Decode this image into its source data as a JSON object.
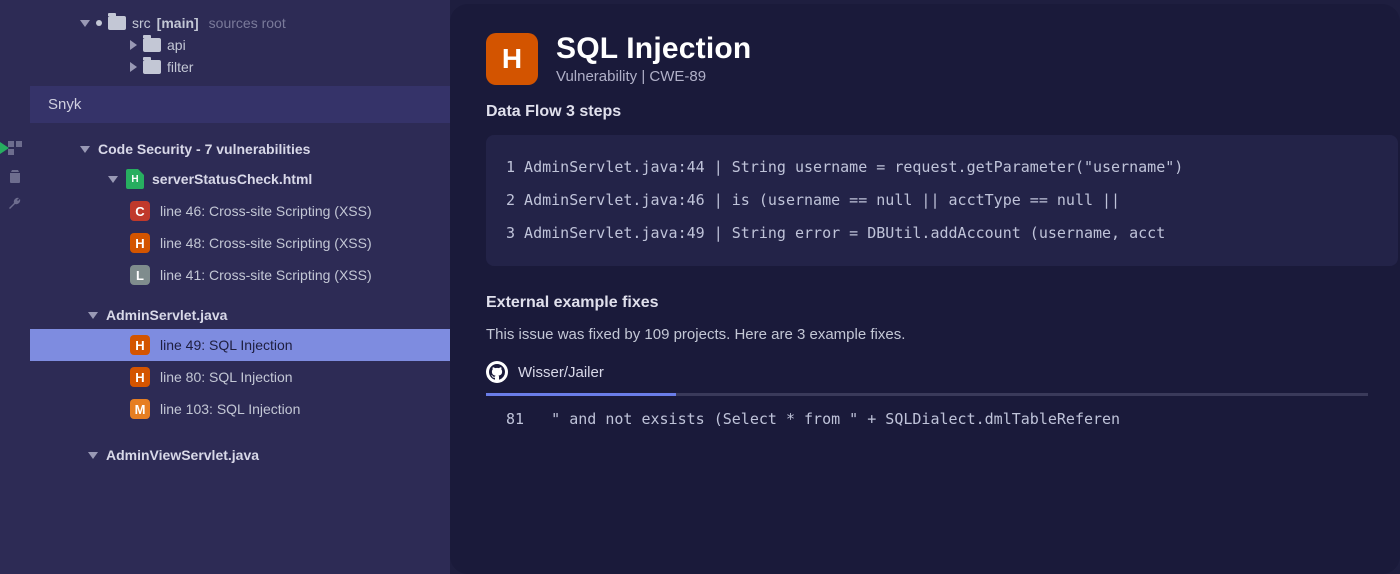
{
  "fileTree": {
    "root": {
      "name": "src",
      "branch": "[main]",
      "desc": "sources root"
    },
    "children": [
      {
        "name": "api"
      },
      {
        "name": "filter"
      }
    ]
  },
  "panelTitle": "Snyk",
  "vulnGroup": "Code Security - 7 vulnerabilities",
  "files": [
    {
      "name": "serverStatusCheck.html",
      "badge": "H",
      "items": [
        {
          "sev": "C",
          "label": "line 46: Cross-site Scripting (XSS)"
        },
        {
          "sev": "H",
          "label": "line 48: Cross-site Scripting (XSS)"
        },
        {
          "sev": "L",
          "label": "line 41: Cross-site Scripting (XSS)"
        }
      ]
    },
    {
      "name": "AdminServlet.java",
      "items": [
        {
          "sev": "H",
          "label": "line 49: SQL Injection",
          "selected": true
        },
        {
          "sev": "H",
          "label": "line 80: SQL Injection"
        },
        {
          "sev": "M",
          "label": "line 103: SQL Injection"
        }
      ]
    },
    {
      "name": "AdminViewServlet.java",
      "items": []
    }
  ],
  "detail": {
    "sev": "H",
    "title": "SQL Injection",
    "subtitle": "Vulnerability | CWE-89",
    "dataFlowLabel": "Data Flow 3 steps",
    "steps": [
      "1 AdminServlet.java:44 | String username = request.getParameter(\"username\")",
      "2 AdminServlet.java:46 | is (username == null || acctType == null ||",
      "3 AdminServlet.java:49 | String error = DBUtil.addAccount (username, acct"
    ],
    "fixesHeader": "External example fixes",
    "fixesDesc": "This issue was fixed by 109 projects. Here are 3 example fixes.",
    "fixRepo": "Wisser/Jailer",
    "fixLineNo": "81",
    "fixCode": "   \" and not exsists (Select * from \" + SQLDialect.dmlTableReferen"
  }
}
